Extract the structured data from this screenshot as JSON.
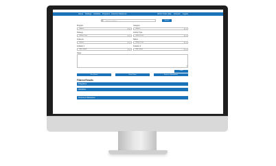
{
  "nav": {
    "left": [
      "Home",
      "Settings",
      "Activities",
      "Programs",
      "Outcome Measures"
    ],
    "right": [
      "Admin Tools",
      "Help",
      "Account",
      "Logout"
    ]
  },
  "search": {
    "placeholder": "Search activities",
    "button": "Search"
  },
  "filters": [
    {
      "label": "Program",
      "value": "-Select-"
    },
    {
      "label": "Category",
      "value": "-Select-"
    },
    {
      "label": "Strategy",
      "value": "-Select One-"
    },
    {
      "label": "Activity Type",
      "value": "-Select One-"
    },
    {
      "label": "Audience",
      "value": "-Select-"
    },
    {
      "label": "Status",
      "value": "-Select One-"
    },
    {
      "label": "Indicator 1",
      "value": "-Not Listed-"
    },
    {
      "label": "Indicator 2",
      "value": "-Not Listed-"
    }
  ],
  "notes_label": "Notes",
  "clear_button": "Clear",
  "actions": [
    "Run Search",
    "Reset Filters",
    "Export to Spreadsheet"
  ],
  "results": {
    "heading": "Filtered Results",
    "sections": [
      "Programs",
      "Activities",
      "Outcome Measures"
    ]
  }
}
